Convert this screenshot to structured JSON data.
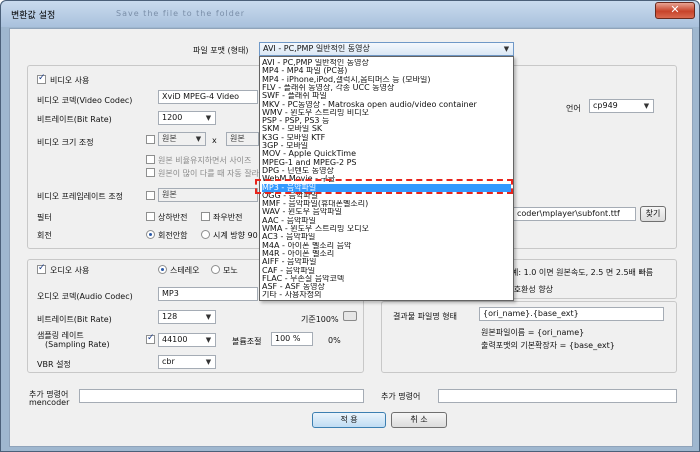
{
  "window": {
    "title": "변환값 설정",
    "blurred_title": "Save the file to the folder",
    "close_symbol": "✕"
  },
  "file_format": {
    "label": "파일 포맷 (형태)",
    "value": "AVI - PC,PMP 일반적인 동영상"
  },
  "video": {
    "enable_label": "비디오 사용",
    "codec_label": "비디오 코덱(Video Codec)",
    "codec_value": "XviD MPEG-4 Video",
    "bitrate_label": "비트레이트(Bit Rate)",
    "bitrate_value": "1200",
    "size_label": "비디오 크기 조정",
    "size_w": "원본",
    "size_x": "x",
    "size_h": "원본",
    "keep_ratio_label": "원본 비율유지하면서 사이즈",
    "many_label": "원본이 많이 다를 때 자동 잘라",
    "fps_label": "비디오 프레임레이트 조정",
    "fps_value": "원본",
    "filter_label": "필터",
    "flip_ud_label": "상하반전",
    "flip_lr_label": "좌우반전",
    "rotate_label": "회전",
    "rotate_none_label": "회전안함",
    "rotate_cw_label": "시계 방향 90"
  },
  "subtitle": {
    "language_label": "언어",
    "language_value": "cp949",
    "path_value": "coder\\mplayer\\subfont.ttf",
    "browse_label": "찾기"
  },
  "audio": {
    "enable_label": "오디오 사용",
    "stereo_label": "스테레오",
    "mono_label": "모노",
    "codec_label": "오디오 코덱(Audio Codec)",
    "codec_value": "MP3",
    "bitrate_label": "비트레이트(Bit Rate)",
    "bitrate_value": "128",
    "sample_label_1": "샘플링 레이트",
    "sample_label_2": "(Sampling Rate)",
    "sample_value": "44100",
    "volume_label": "볼륨조절",
    "volume_value": "100 %",
    "volume_right": "0%",
    "base_label": "기준100%",
    "vbr_label": "VBR 설정",
    "vbr_value": "cbr"
  },
  "speed": {
    "example_label": "예: 1.0 이면 원본속도, 2.5 면 2.5배 빠름",
    "compat_label": "/호환성 향상"
  },
  "output": {
    "filename_label": "결과물 파일명 형태",
    "filename_value": "{ori_name}.{base_ext}",
    "hint1": "원본파일이름 = {ori_name}",
    "hint2": "출력포맷의 기본확장자 = {base_ext}"
  },
  "extra": {
    "cmd_label_1": "추가 명령어",
    "cmd_label_2": "mencoder",
    "cmd_label_right": "추가 명령어"
  },
  "buttons": {
    "apply": "적 용",
    "cancel": "취 소"
  },
  "format_options": [
    "AVI - PC,PMP 일반적인 동영상",
    "MP4 - MP4 파일 (PC용)",
    "MP4 - iPhone,iPod,갤럭시,옵티머스 등 (모바일)",
    "FLV - 플래쉬 동영상, 각종 UCC 동영상",
    "SWF - 플래쉬 파일",
    "MKV - PC동영상 - Matroska open audio/video container",
    "WMV - 윈도우 스트리밍 비디오",
    "PSP - PSP, PS3 등",
    "SKM - 모바일 SK",
    "K3G - 모바일 KTF",
    "3GP - 모바일",
    "MOV - Apple QuickTime",
    "MPEG-1 and MPEG-2 PS",
    "DPG - 닌텐도 동영상",
    "WebM Movie - 구글",
    "MP3 - 음악파일",
    "OGG - 음악파일",
    "MMF - 음악파일(휴대폰벨소리)",
    "WAV - 윈도우 음악파일",
    "AAC - 음악파일",
    "WMA - 윈도우 스트리밍 오디오",
    "AC3 - 음악파일",
    "M4A - 아이폰 벨소리 음악",
    "M4R - 아이폰 벨소리",
    "AIFF - 음악파일",
    "CAF - 음악파일",
    "FLAC - 무손실 음악코덱",
    "ASF - ASF 동영상",
    "기타 - 사용자정의"
  ],
  "selected_index": 15
}
